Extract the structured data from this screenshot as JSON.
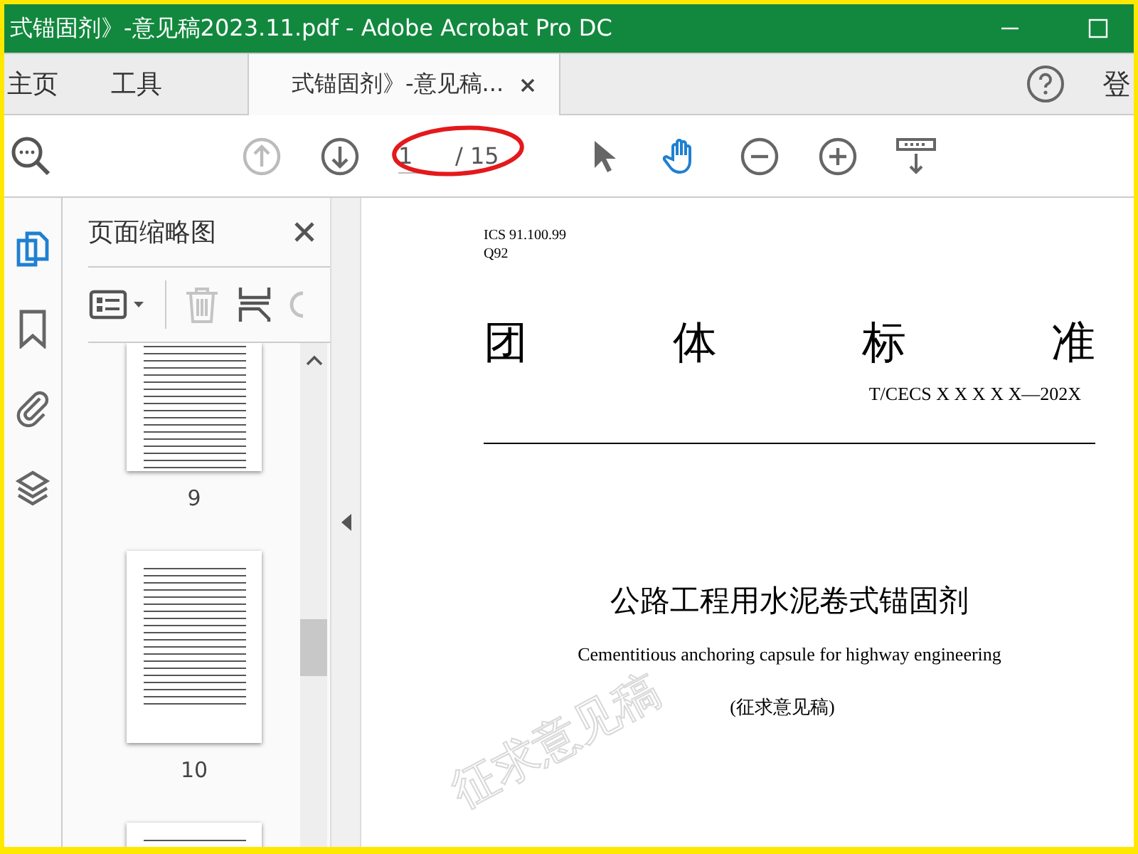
{
  "window": {
    "title": "式锚固剂》-意见稿2023.11.pdf - Adobe Acrobat Pro DC"
  },
  "menu_tabs": [
    {
      "label": "主页"
    },
    {
      "label": "工具"
    }
  ],
  "document_tab": {
    "label": "式锚固剂》-意见稿..."
  },
  "account": {
    "label": "登"
  },
  "toolbar": {
    "page_current": "1",
    "page_total": "/ 15",
    "tools": [
      {
        "kind": "page-up",
        "disabled": true,
        "selected": false
      },
      {
        "kind": "page-down",
        "disabled": false,
        "selected": false
      },
      {
        "kind": "pointer",
        "disabled": false,
        "selected": false
      },
      {
        "kind": "hand",
        "disabled": false,
        "selected": true
      },
      {
        "kind": "zoom-out",
        "disabled": false,
        "selected": false
      },
      {
        "kind": "zoom-in",
        "disabled": false,
        "selected": false
      },
      {
        "kind": "keyboard",
        "disabled": false,
        "selected": false
      }
    ]
  },
  "nav_rail": [
    {
      "kind": "pages",
      "selected": true
    },
    {
      "kind": "bookmark",
      "selected": false
    },
    {
      "kind": "attachment",
      "selected": false
    },
    {
      "kind": "layers",
      "selected": false
    }
  ],
  "thumbnail_panel": {
    "title": "页面缩略图",
    "thumbnails": [
      {
        "label": "9"
      },
      {
        "label": "10"
      }
    ]
  },
  "document": {
    "ics": "ICS  91.100.99",
    "classification": "Q92",
    "heading": [
      "团",
      "体",
      "标",
      "准"
    ],
    "standard_number": "T/CECS X X X X X—202X",
    "title": "公路工程用水泥卷式锚固剂",
    "subtitle": "Cementitious anchoring capsule for highway engineering",
    "status": "(征求意见稿)",
    "watermark": "征求意见稿"
  }
}
